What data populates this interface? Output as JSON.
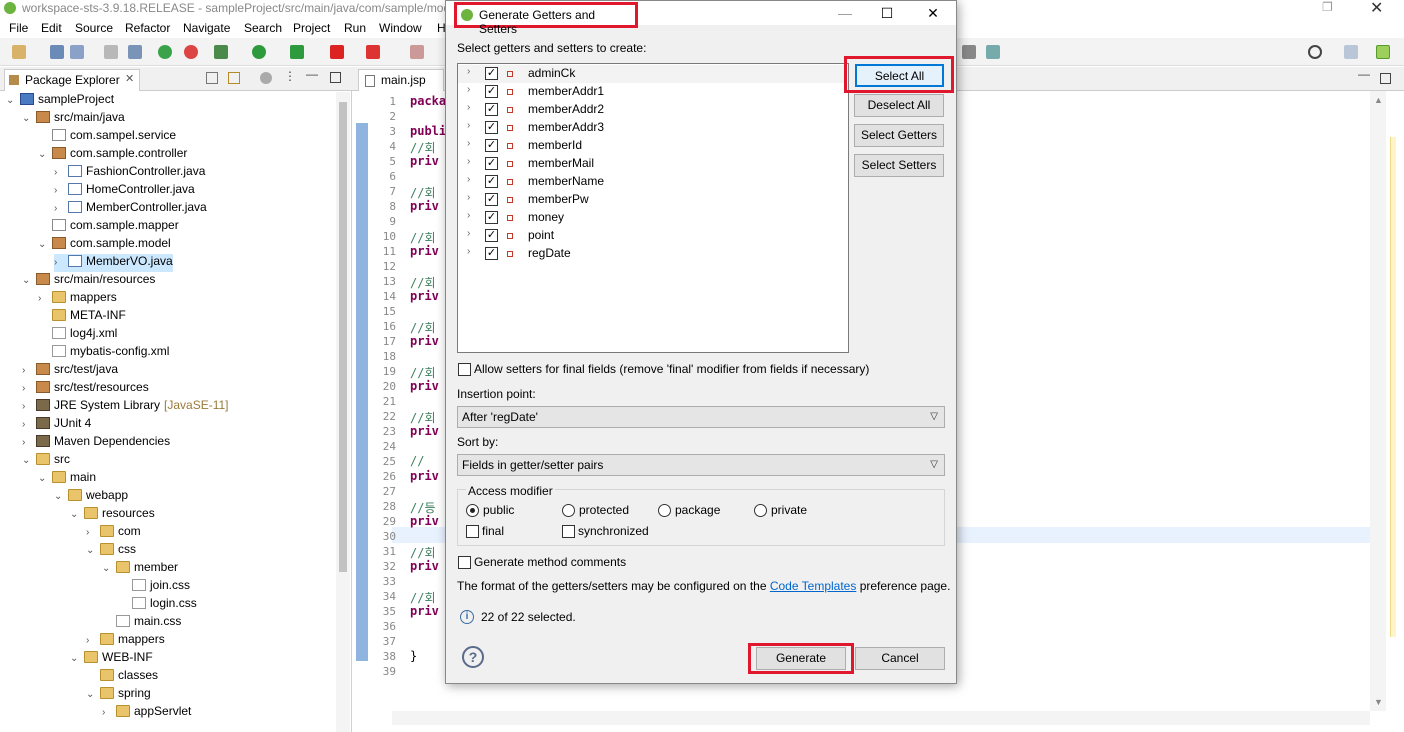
{
  "window": {
    "title": "workspace-sts-3.9.18.RELEASE - sampleProject/src/main/java/com/sample/mod"
  },
  "menu": [
    "File",
    "Edit",
    "Source",
    "Refactor",
    "Navigate",
    "Search",
    "Project",
    "Run",
    "Window",
    "H"
  ],
  "explorer": {
    "tab_label": "Package Explorer",
    "tree": [
      {
        "label": "sampleProject",
        "depth": 0,
        "icon": "project-icon",
        "expanded": true
      },
      {
        "label": "src/main/java",
        "depth": 1,
        "icon": "source-folder-icon",
        "expanded": true
      },
      {
        "label": "com.sampel.service",
        "depth": 2,
        "icon": "empty-package-icon"
      },
      {
        "label": "com.sample.controller",
        "depth": 2,
        "icon": "package-icon",
        "expanded": true
      },
      {
        "label": "FashionController.java",
        "depth": 3,
        "icon": "java-file-icon",
        "collapsed": true
      },
      {
        "label": "HomeController.java",
        "depth": 3,
        "icon": "java-file-icon",
        "collapsed": true
      },
      {
        "label": "MemberController.java",
        "depth": 3,
        "icon": "java-file-icon",
        "collapsed": true
      },
      {
        "label": "com.sample.mapper",
        "depth": 2,
        "icon": "empty-package-icon"
      },
      {
        "label": "com.sample.model",
        "depth": 2,
        "icon": "package-icon",
        "expanded": true
      },
      {
        "label": "MemberVO.java",
        "depth": 3,
        "icon": "java-file-icon",
        "collapsed": true,
        "selected": true
      },
      {
        "label": "src/main/resources",
        "depth": 1,
        "icon": "source-folder-icon",
        "expanded": true
      },
      {
        "label": "mappers",
        "depth": 2,
        "icon": "folder-icon",
        "collapsed": true
      },
      {
        "label": "META-INF",
        "depth": 2,
        "icon": "folder-icon"
      },
      {
        "label": "log4j.xml",
        "depth": 2,
        "icon": "xml-file-icon"
      },
      {
        "label": "mybatis-config.xml",
        "depth": 2,
        "icon": "xml-file-icon"
      },
      {
        "label": "src/test/java",
        "depth": 1,
        "icon": "source-folder-icon",
        "collapsed": true
      },
      {
        "label": "src/test/resources",
        "depth": 1,
        "icon": "source-folder-icon",
        "collapsed": true
      },
      {
        "label": "JRE System Library",
        "suffix": "[JavaSE-11]",
        "depth": 1,
        "icon": "library-icon",
        "collapsed": true
      },
      {
        "label": "JUnit 4",
        "depth": 1,
        "icon": "library-icon",
        "collapsed": true
      },
      {
        "label": "Maven Dependencies",
        "depth": 1,
        "icon": "library-icon",
        "collapsed": true
      },
      {
        "label": "src",
        "depth": 1,
        "icon": "folder-icon",
        "expanded": true
      },
      {
        "label": "main",
        "depth": 2,
        "icon": "folder-icon",
        "expanded": true
      },
      {
        "label": "webapp",
        "depth": 3,
        "icon": "folder-icon",
        "expanded": true
      },
      {
        "label": "resources",
        "depth": 4,
        "icon": "folder-icon",
        "expanded": true
      },
      {
        "label": "com",
        "depth": 5,
        "icon": "folder-icon",
        "collapsed": true
      },
      {
        "label": "css",
        "depth": 5,
        "icon": "folder-icon",
        "expanded": true
      },
      {
        "label": "member",
        "depth": 6,
        "icon": "folder-icon",
        "expanded": true
      },
      {
        "label": "join.css",
        "depth": 7,
        "icon": "text-file-icon"
      },
      {
        "label": "login.css",
        "depth": 7,
        "icon": "text-file-icon"
      },
      {
        "label": "main.css",
        "depth": 6,
        "icon": "text-file-icon"
      },
      {
        "label": "mappers",
        "depth": 5,
        "icon": "folder-icon",
        "collapsed": true
      },
      {
        "label": "WEB-INF",
        "depth": 4,
        "icon": "folder-icon",
        "expanded": true
      },
      {
        "label": "classes",
        "depth": 5,
        "icon": "folder-icon"
      },
      {
        "label": "spring",
        "depth": 5,
        "icon": "folder-icon",
        "expanded": true
      },
      {
        "label": "appServlet",
        "depth": 6,
        "icon": "folder-icon",
        "collapsed": true
      }
    ]
  },
  "editor": {
    "tab_label": "main.jsp",
    "lines": [
      {
        "n": "1",
        "text": "package",
        "kind": "kw"
      },
      {
        "n": "2",
        "text": "",
        "kind": "kw"
      },
      {
        "n": "3",
        "text": "public c",
        "kind": "kw"
      },
      {
        "n": "4",
        "text": "    //회",
        "kind": "comment"
      },
      {
        "n": "5",
        "text": "    priv",
        "kind": "kw"
      },
      {
        "n": "6",
        "text": "",
        "kind": "kw"
      },
      {
        "n": "7",
        "text": "    //회",
        "kind": "comment"
      },
      {
        "n": "8",
        "text": "    priv",
        "kind": "kw"
      },
      {
        "n": "9",
        "text": "",
        "kind": "kw"
      },
      {
        "n": "10",
        "text": "    //회",
        "kind": "comment"
      },
      {
        "n": "11",
        "text": "    priv",
        "kind": "kw"
      },
      {
        "n": "12",
        "text": "",
        "kind": "kw"
      },
      {
        "n": "13",
        "text": "    //회",
        "kind": "comment"
      },
      {
        "n": "14",
        "text": "    priv",
        "kind": "kw"
      },
      {
        "n": "15",
        "text": "",
        "kind": "kw"
      },
      {
        "n": "16",
        "text": "    //회",
        "kind": "comment"
      },
      {
        "n": "17",
        "text": "    priv",
        "kind": "kw"
      },
      {
        "n": "18",
        "text": "",
        "kind": "kw"
      },
      {
        "n": "19",
        "text": "    //회",
        "kind": "comment"
      },
      {
        "n": "20",
        "text": "    priv",
        "kind": "kw"
      },
      {
        "n": "21",
        "text": "",
        "kind": "kw"
      },
      {
        "n": "22",
        "text": "    //회",
        "kind": "comment"
      },
      {
        "n": "23",
        "text": "    priv",
        "kind": "kw"
      },
      {
        "n": "24",
        "text": "",
        "kind": "kw"
      },
      {
        "n": "25",
        "text": "    // ",
        "kind": "comment"
      },
      {
        "n": "26",
        "text": "    priv",
        "kind": "kw"
      },
      {
        "n": "27",
        "text": "",
        "kind": "kw"
      },
      {
        "n": "28",
        "text": "    //등",
        "kind": "comment"
      },
      {
        "n": "29",
        "text": "    priv",
        "kind": "kw"
      },
      {
        "n": "30",
        "text": "",
        "kind": "kw"
      },
      {
        "n": "31",
        "text": "    //회",
        "kind": "comment"
      },
      {
        "n": "32",
        "text": "    priv",
        "kind": "kw"
      },
      {
        "n": "33",
        "text": "",
        "kind": "kw"
      },
      {
        "n": "34",
        "text": "    //회",
        "kind": "comment"
      },
      {
        "n": "35",
        "text": "    priv",
        "kind": "kw"
      },
      {
        "n": "36",
        "text": "",
        "kind": "kw"
      },
      {
        "n": "37",
        "text": "",
        "kind": "kw"
      },
      {
        "n": "38",
        "text": "}",
        "kind": "plain"
      },
      {
        "n": "39",
        "text": "",
        "kind": "kw"
      }
    ]
  },
  "dialog": {
    "title": "Generate Getters and Setters",
    "prompt": "Select getters and setters to create:",
    "fields": [
      {
        "name": "adminCk",
        "checked": true
      },
      {
        "name": "memberAddr1",
        "checked": true
      },
      {
        "name": "memberAddr2",
        "checked": true
      },
      {
        "name": "memberAddr3",
        "checked": true
      },
      {
        "name": "memberId",
        "checked": true
      },
      {
        "name": "memberMail",
        "checked": true
      },
      {
        "name": "memberName",
        "checked": true
      },
      {
        "name": "memberPw",
        "checked": true
      },
      {
        "name": "money",
        "checked": true
      },
      {
        "name": "point",
        "checked": true
      },
      {
        "name": "regDate",
        "checked": true
      }
    ],
    "buttons": {
      "select_all": "Select All",
      "deselect_all": "Deselect All",
      "select_getters": "Select Getters",
      "select_setters": "Select Setters",
      "generate": "Generate",
      "cancel": "Cancel"
    },
    "allow_setters_final": {
      "label": "Allow setters for final fields (remove 'final' modifier from fields if necessary)",
      "checked": false
    },
    "insertion_point": {
      "label": "Insertion point:",
      "value": "After 'regDate'"
    },
    "sort_by": {
      "label": "Sort by:",
      "value": "Fields in getter/setter pairs"
    },
    "access_modifier": {
      "label": "Access modifier",
      "options": [
        {
          "label": "public",
          "selected": true
        },
        {
          "label": "protected",
          "selected": false
        },
        {
          "label": "package",
          "selected": false
        },
        {
          "label": "private",
          "selected": false
        }
      ],
      "final_label": "final",
      "synchronized_label": "synchronized"
    },
    "generate_comments": {
      "label": "Generate method comments",
      "checked": false
    },
    "format_text_before": "The format of the getters/setters may be configured on the",
    "format_link": "Code Templates",
    "format_text_after": "preference page.",
    "selection_status": "22 of 22 selected."
  },
  "colors": {
    "highlight_red": "#e0182d",
    "selection_blue": "#cce8ff",
    "link": "#0066cc"
  }
}
